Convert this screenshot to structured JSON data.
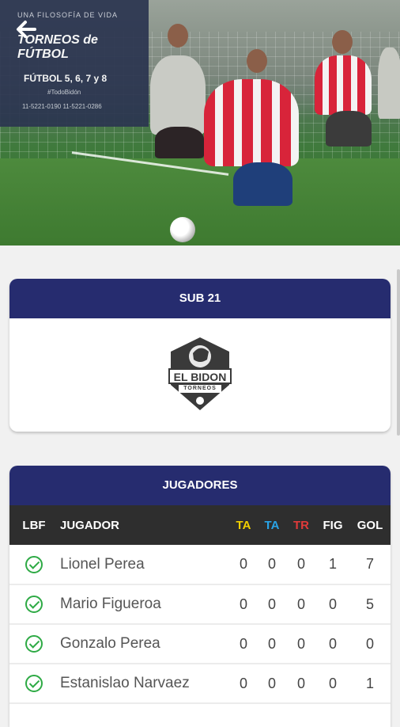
{
  "banner": {
    "line1": "UNA FILOSOFÍA DE VIDA",
    "line2": "TORNEOS de FÚTBOL",
    "line3": "FÚTBOL 5, 6, 7 y 8",
    "line4": "#TodoBidón",
    "line5": "11-5221-0190  11-5221-0286"
  },
  "team_card": {
    "title": "SUB 21",
    "logo_text_1": "EL BIDON",
    "logo_text_2": "TORNEOS"
  },
  "players_card": {
    "title": "JUGADORES",
    "columns": {
      "lbf": "LBF",
      "jugador": "JUGADOR",
      "ta_yellow": "TA",
      "ta_blue": "TA",
      "tr": "TR",
      "fig": "FIG",
      "gol": "GOL"
    },
    "rows": [
      {
        "name": "Lionel Perea",
        "ta_yellow": "0",
        "ta_blue": "0",
        "tr": "0",
        "fig": "1",
        "gol": "7"
      },
      {
        "name": "Mario Figueroa",
        "ta_yellow": "0",
        "ta_blue": "0",
        "tr": "0",
        "fig": "0",
        "gol": "5"
      },
      {
        "name": "Gonzalo Perea",
        "ta_yellow": "0",
        "ta_blue": "0",
        "tr": "0",
        "fig": "0",
        "gol": "0"
      },
      {
        "name": "Estanislao Narvaez",
        "ta_yellow": "0",
        "ta_blue": "0",
        "tr": "0",
        "fig": "0",
        "gol": "1"
      }
    ]
  },
  "colors": {
    "header_navy": "#262c6f",
    "table_header": "#2e2e2e",
    "ta_yellow": "#f2d000",
    "ta_blue": "#29a3e6",
    "tr_red": "#e03a3a",
    "check_green": "#2eaa45"
  },
  "icons": {
    "back": "arrow-left-icon",
    "check": "check-circle-icon"
  }
}
